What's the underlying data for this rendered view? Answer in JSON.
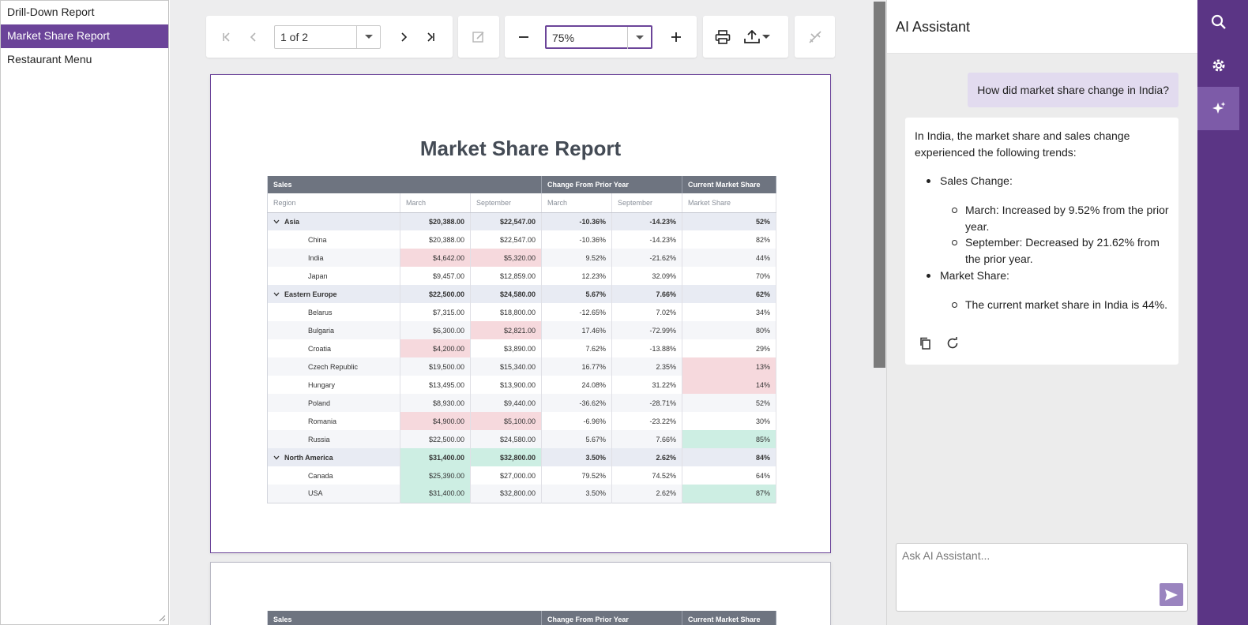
{
  "reports_list": {
    "items": [
      {
        "label": "Drill-Down Report"
      },
      {
        "label": "Market Share Report"
      },
      {
        "label": "Restaurant Menu"
      }
    ],
    "active_index": 1
  },
  "toolbar": {
    "page_selector_value": "1 of 2",
    "zoom_value": "75%"
  },
  "report": {
    "title": "Market Share Report",
    "header_groups": [
      "Sales",
      "Change From Prior Year",
      "Current Market Share"
    ],
    "column_headers": [
      "Region",
      "March",
      "September",
      "March",
      "September",
      "Market Share"
    ],
    "rows": [
      {
        "kind": "region",
        "name": "Asia",
        "march": "$20,388.00",
        "september": "$22,547.00",
        "chg_march": "-10.36%",
        "chg_september": "-14.23%",
        "share": "52%"
      },
      {
        "kind": "country",
        "name": "China",
        "march": "$20,388.00",
        "september": "$22,547.00",
        "chg_march": "-10.36%",
        "chg_september": "-14.23%",
        "share": "82%"
      },
      {
        "kind": "country",
        "name": "India",
        "march": "$4,642.00",
        "september": "$5,320.00",
        "chg_march": "9.52%",
        "chg_september": "-21.62%",
        "share": "44%"
      },
      {
        "kind": "country",
        "name": "Japan",
        "march": "$9,457.00",
        "september": "$12,859.00",
        "chg_march": "12.23%",
        "chg_september": "32.09%",
        "share": "70%"
      },
      {
        "kind": "region",
        "name": "Eastern Europe",
        "march": "$22,500.00",
        "september": "$24,580.00",
        "chg_march": "5.67%",
        "chg_september": "7.66%",
        "share": "62%"
      },
      {
        "kind": "country",
        "name": "Belarus",
        "march": "$7,315.00",
        "september": "$18,800.00",
        "chg_march": "-12.65%",
        "chg_september": "7.02%",
        "share": "34%"
      },
      {
        "kind": "country",
        "name": "Bulgaria",
        "march": "$6,300.00",
        "september": "$2,821.00",
        "chg_march": "17.46%",
        "chg_september": "-72.99%",
        "share": "80%"
      },
      {
        "kind": "country",
        "name": "Croatia",
        "march": "$4,200.00",
        "september": "$3,890.00",
        "chg_march": "7.62%",
        "chg_september": "-13.88%",
        "share": "29%"
      },
      {
        "kind": "country",
        "name": "Czech Republic",
        "march": "$19,500.00",
        "september": "$15,340.00",
        "chg_march": "16.77%",
        "chg_september": "2.35%",
        "share": "13%"
      },
      {
        "kind": "country",
        "name": "Hungary",
        "march": "$13,495.00",
        "september": "$13,900.00",
        "chg_march": "24.08%",
        "chg_september": "31.22%",
        "share": "14%"
      },
      {
        "kind": "country",
        "name": "Poland",
        "march": "$8,930.00",
        "september": "$9,440.00",
        "chg_march": "-36.62%",
        "chg_september": "-28.71%",
        "share": "52%"
      },
      {
        "kind": "country",
        "name": "Romania",
        "march": "$4,900.00",
        "september": "$5,100.00",
        "chg_march": "-6.96%",
        "chg_september": "-23.22%",
        "share": "30%"
      },
      {
        "kind": "country",
        "name": "Russia",
        "march": "$22,500.00",
        "september": "$24,580.00",
        "chg_march": "5.67%",
        "chg_september": "7.66%",
        "share": "85%"
      },
      {
        "kind": "region",
        "name": "North America",
        "march": "$31,400.00",
        "september": "$32,800.00",
        "chg_march": "3.50%",
        "chg_september": "2.62%",
        "share": "84%"
      },
      {
        "kind": "country",
        "name": "Canada",
        "march": "$25,390.00",
        "september": "$27,000.00",
        "chg_march": "79.52%",
        "chg_september": "74.52%",
        "share": "64%"
      },
      {
        "kind": "country",
        "name": "USA",
        "march": "$31,400.00",
        "september": "$32,800.00",
        "chg_march": "3.50%",
        "chg_september": "2.62%",
        "share": "87%"
      }
    ],
    "highlight_red": [
      "India.march",
      "India.september",
      "Bulgaria.september",
      "Croatia.march",
      "Czech Republic.share",
      "Hungary.share",
      "Romania.march",
      "Romania.september"
    ],
    "highlight_green": [
      "Russia.share",
      "North America.march",
      "North America.september",
      "Canada.march",
      "USA.march",
      "USA.share"
    ],
    "page2_header_groups": [
      "Sales",
      "Change From Prior Year",
      "Current Market Share"
    ]
  },
  "assistant": {
    "title": "AI Assistant",
    "user_message": "How did market share change in India?",
    "response_intro": "In India, the market share and sales change experienced the following trends:",
    "sales_change_label": "Sales Change:",
    "sales_march": "March: Increased by 9.52% from the prior year.",
    "sales_september": "September: Decreased by 21.62% from the prior year.",
    "market_share_label": "Market Share:",
    "market_share_text": "The current market share in India is 44%.",
    "input_placeholder": "Ask AI Assistant..."
  },
  "colors": {
    "accent": "#6b4499",
    "rail": "#5b3585",
    "negative": "#c8203f",
    "positive": "#1f9c72",
    "highlight_red": "#f6d9dd",
    "highlight_green": "#cdeee3"
  },
  "icons": {
    "rail": [
      "search-icon",
      "gear-icon",
      "sparkle-icon"
    ],
    "toolbar": [
      "first-page-icon",
      "previous-page-icon",
      "next-page-icon",
      "last-page-icon",
      "edit-icon",
      "zoom-out-icon",
      "zoom-in-icon",
      "print-icon",
      "export-icon",
      "highlight-off-icon"
    ],
    "assistant": [
      "copy-icon",
      "refresh-icon",
      "send-icon"
    ]
  }
}
